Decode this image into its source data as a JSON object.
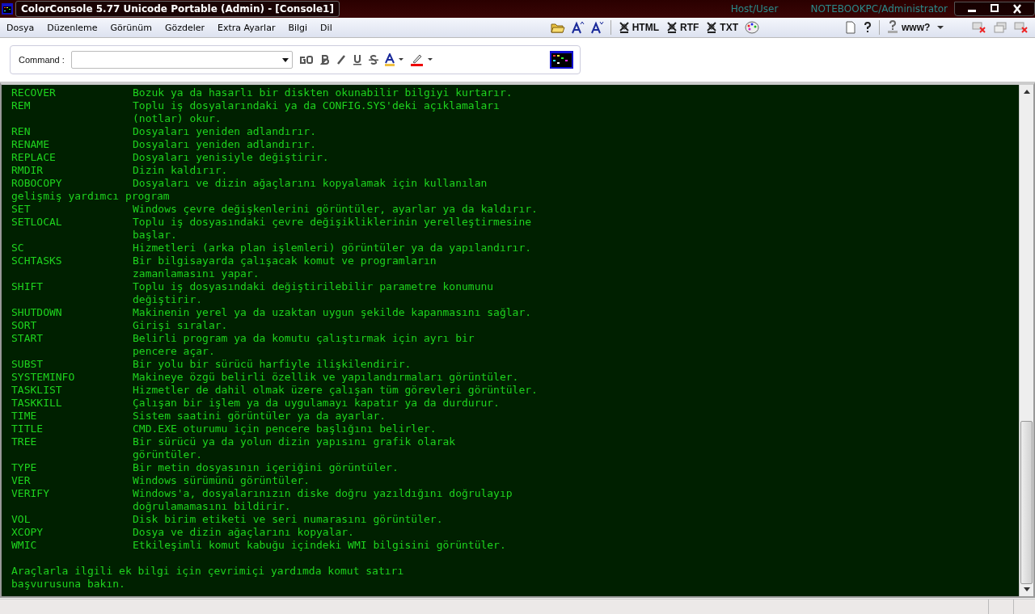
{
  "window": {
    "title": "ColorConsole 5.77 Unicode Portable (Admin) - [Console1]",
    "host_label": "Host/User",
    "host_value": "NOTEBOOKPC/Administrator"
  },
  "menu": [
    "Dosya",
    "Düzenleme",
    "Görünüm",
    "Gözdeler",
    "Extra Ayarlar",
    "Bilgi",
    "Dil"
  ],
  "export_buttons": [
    "HTML",
    "RTF",
    "TXT"
  ],
  "www_button": "www?",
  "command_bar": {
    "label": "Command :"
  },
  "console": {
    "lines": [
      {
        "kind": "entry",
        "command": "RECOVER",
        "text": "Bozuk ya da hasarlı bir diskten okunabilir bilgiyi kurtarır."
      },
      {
        "kind": "entry",
        "command": "REM",
        "text": "Toplu iş dosyalarındaki ya da CONFIG.SYS'deki açıklamaları"
      },
      {
        "kind": "cont",
        "text": "(notlar) okur."
      },
      {
        "kind": "entry",
        "command": "REN",
        "text": "Dosyaları yeniden adlandırır."
      },
      {
        "kind": "entry",
        "command": "RENAME",
        "text": "Dosyaları yeniden adlandırır."
      },
      {
        "kind": "entry",
        "command": "REPLACE",
        "text": "Dosyaları yenisiyle değiştirir."
      },
      {
        "kind": "entry",
        "command": "RMDIR",
        "text": "Dizin kaldırır."
      },
      {
        "kind": "entry",
        "command": "ROBOCOPY",
        "text": "Dosyaları ve dizin ağaçlarını kopyalamak için kullanılan"
      },
      {
        "kind": "full",
        "text": "gelişmiş yardımcı program"
      },
      {
        "kind": "entry",
        "command": "SET",
        "text": "Windows çevre değişkenlerini görüntüler, ayarlar ya da kaldırır."
      },
      {
        "kind": "entry",
        "command": "SETLOCAL",
        "text": "Toplu iş dosyasındaki çevre değişikliklerinin yerelleştirmesine"
      },
      {
        "kind": "cont",
        "text": "başlar."
      },
      {
        "kind": "entry",
        "command": "SC",
        "text": "Hizmetleri (arka plan işlemleri) görüntüler ya da yapılandırır."
      },
      {
        "kind": "entry",
        "command": "SCHTASKS",
        "text": "Bir bilgisayarda çalışacak komut ve programların"
      },
      {
        "kind": "cont",
        "text": "zamanlamasını yapar."
      },
      {
        "kind": "entry",
        "command": "SHIFT",
        "text": "Toplu iş dosyasındaki değiştirilebilir parametre konumunu"
      },
      {
        "kind": "cont",
        "text": "değiştirir."
      },
      {
        "kind": "entry",
        "command": "SHUTDOWN",
        "text": "Makinenin yerel ya da uzaktan uygun şekilde kapanmasını sağlar."
      },
      {
        "kind": "entry",
        "command": "SORT",
        "text": "Girişi sıralar."
      },
      {
        "kind": "entry",
        "command": "START",
        "text": "Belirli program ya da komutu çalıştırmak için ayrı bir"
      },
      {
        "kind": "cont",
        "text": "pencere açar."
      },
      {
        "kind": "entry",
        "command": "SUBST",
        "text": "Bir yolu bir sürücü harfiyle ilişkilendirir."
      },
      {
        "kind": "entry",
        "command": "SYSTEMINFO",
        "text": "Makineye özgü belirli özellik ve yapılandırmaları görüntüler."
      },
      {
        "kind": "entry",
        "command": "TASKLIST",
        "text": "Hizmetler de dahil olmak üzere çalışan tüm görevleri görüntüler."
      },
      {
        "kind": "entry",
        "command": "TASKKILL",
        "text": "Çalışan bir işlem ya da uygulamayı kapatır ya da durdurur."
      },
      {
        "kind": "entry",
        "command": "TIME",
        "text": "Sistem saatini görüntüler ya da ayarlar."
      },
      {
        "kind": "entry",
        "command": "TITLE",
        "text": "CMD.EXE oturumu için pencere başlığını belirler."
      },
      {
        "kind": "entry",
        "command": "TREE",
        "text": "Bir sürücü ya da yolun dizin yapısını grafik olarak"
      },
      {
        "kind": "cont",
        "text": "görüntüler."
      },
      {
        "kind": "entry",
        "command": "TYPE",
        "text": "Bir metin dosyasının içeriğini görüntüler."
      },
      {
        "kind": "entry",
        "command": "VER",
        "text": "Windows sürümünü görüntüler."
      },
      {
        "kind": "entry",
        "command": "VERIFY",
        "text": "Windows'a, dosyalarınızın diske doğru yazıldığını doğrulayıp"
      },
      {
        "kind": "cont",
        "text": "doğrulamamasını bildirir."
      },
      {
        "kind": "entry",
        "command": "VOL",
        "text": "Disk birim etiketi ve seri numarasını görüntüler."
      },
      {
        "kind": "entry",
        "command": "XCOPY",
        "text": "Dosya ve dizin ağaçlarını kopyalar."
      },
      {
        "kind": "entry",
        "command": "WMIC",
        "text": "Etkileşimli komut kabuğu içindeki WMI bilgisini görüntüler."
      },
      {
        "kind": "blank"
      },
      {
        "kind": "full",
        "text": "Araçlarla ilgili ek bilgi için çevrimiçi yardımda komut satırı"
      },
      {
        "kind": "full",
        "text": "başvurusuna bakın."
      }
    ]
  }
}
